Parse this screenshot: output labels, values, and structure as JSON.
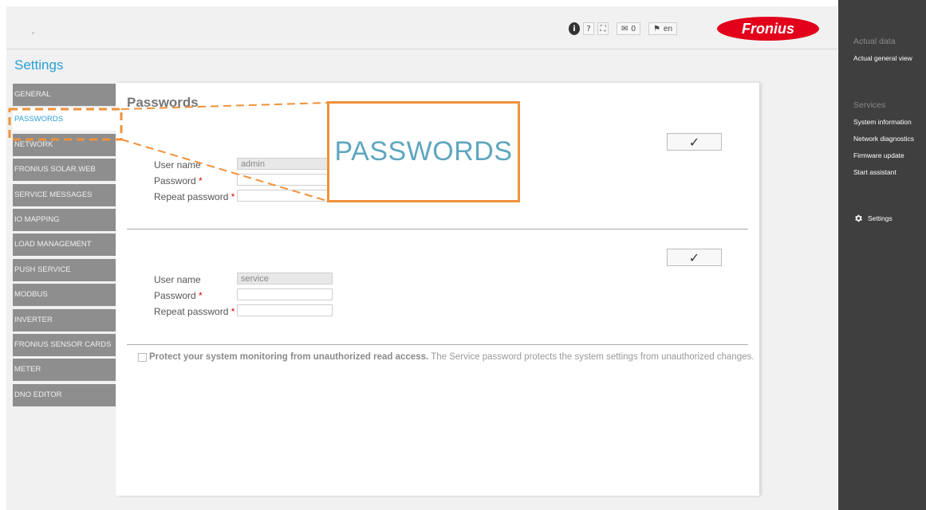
{
  "toolbar": {
    "info_label": "i",
    "help_label": "?",
    "fullscreen_label": "⛶",
    "messages_count": "0",
    "language": "en"
  },
  "brand": {
    "logo_text": "Fronius",
    "accent_color": "#e2001a",
    "link_color": "#2a9fd6"
  },
  "page": {
    "title": "Settings"
  },
  "nav": {
    "items": [
      "GENERAL",
      "PASSWORDS",
      "NETWORK",
      "FRONIUS SOLAR.WEB",
      "SERVICE MESSAGES",
      "IO MAPPING",
      "LOAD MANAGEMENT",
      "PUSH SERVICE",
      "MODBUS",
      "INVERTER",
      "FRONIUS SENSOR CARDS",
      "METER",
      "DNO EDITOR"
    ],
    "active_index": 1
  },
  "passwords": {
    "title": "Passwords",
    "admin": {
      "username_label": "User name",
      "username_value": "admin",
      "password_label": "Password",
      "repeat_label": "Repeat password",
      "required_mark": "*"
    },
    "service": {
      "username_label": "User name",
      "username_value": "service",
      "password_label": "Password",
      "repeat_label": "Repeat password",
      "required_mark": "*"
    },
    "confirm_icon": "✓",
    "protect_bold": "Protect your system monitoring from unauthorized read access.",
    "protect_text": " The Service password protects the system settings from unauthorized changes."
  },
  "callout": {
    "text": "PASSWORDS",
    "color": "#f0923a"
  },
  "right_panel": {
    "actual_data_heading": "Actual data",
    "actual_general_view": "Actual general view",
    "services_heading": "Services",
    "system_information": "System information",
    "network_diagnostics": "Network diagnostics",
    "firmware_update": "Firmware update",
    "start_assistant": "Start assistant",
    "settings": "Settings"
  }
}
